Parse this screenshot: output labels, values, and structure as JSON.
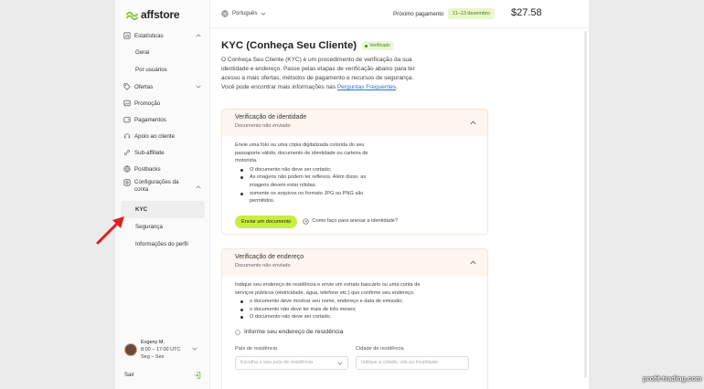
{
  "brand": {
    "name": "affstore",
    "accent": "#c7ef3e"
  },
  "sidebar": {
    "stats": {
      "label": "Estatísticas",
      "sub": [
        "Geral",
        "Por usuários"
      ]
    },
    "offers": {
      "label": "Ofertas"
    },
    "promo": {
      "label": "Promoção"
    },
    "payments": {
      "label": "Pagamentos"
    },
    "support": {
      "label": "Apoio ao cliente"
    },
    "subaffiliate": {
      "label": "Sub-affiliate"
    },
    "postbacks": {
      "label": "Postbacks"
    },
    "account": {
      "label": "Configurações da conta",
      "sub": [
        "KYC",
        "Segurança",
        "Informações do perfil"
      ]
    },
    "user": {
      "name": "Evgeny M.",
      "hours": "8:00 – 17:00 UTC",
      "days": "Seg – Sex"
    },
    "logout": "Sair"
  },
  "topbar": {
    "language": "Português",
    "next_payment_label": "Próximo pagamento",
    "next_payment_dates": "11–13 dezembro",
    "balance": "$27.58"
  },
  "kyc": {
    "title": "KYC (Conheça Seu Cliente)",
    "status": "Verificado",
    "intro": "O Conheça Seu Cliente (KYC) é um procedimento de verificação da sua identidade e endereço. Passe pelas etapas de verificação abaixo para ter acesso a mais ofertas, métodos de pagamento e recursos de segurança. Você pode encontrar mais informações nas",
    "faq_link": "Perguntas Frequentes",
    "period": "."
  },
  "identity": {
    "title": "Verificação de identidade",
    "status": "Documento não enviado",
    "description": "Envie uma foto ou uma cópia digitalizada colorida do seu passaporte válido, documento de identidade ou carteira de motorista.",
    "rules": [
      "O documento não deve ser cortado;",
      "As imagens não podem ter reflexos. Além disso, as imagens devem estar nítidas.",
      "somente os arquivos no formato JPG ou PNG são permitidos."
    ],
    "upload_button": "Enviar um documento",
    "help_link": "Como faço para anexar a identidade?"
  },
  "address": {
    "title": "Verificação de endereço",
    "status": "Documento não enviado",
    "description": "Indique seu endereço de residência e envie um extrato bancário ou uma conta de serviços públicos (eletricidade, água, telefone etc.) que confirme seu endereço.",
    "rules": [
      "o documento deve mostrar seu nome, endereço e data de emissão;",
      "o documento não deve ter mais de três meses;",
      "O documento não deve ser cortado."
    ],
    "radio_label": "Informe seu endereço de residência",
    "country_label": "País de residência",
    "country_placeholder": "Escolha o seu país de residência",
    "city_label": "Cidade de residência",
    "city_placeholder": "Indique a cidade, vila ou localidade"
  },
  "watermark": "profit-trading.com"
}
